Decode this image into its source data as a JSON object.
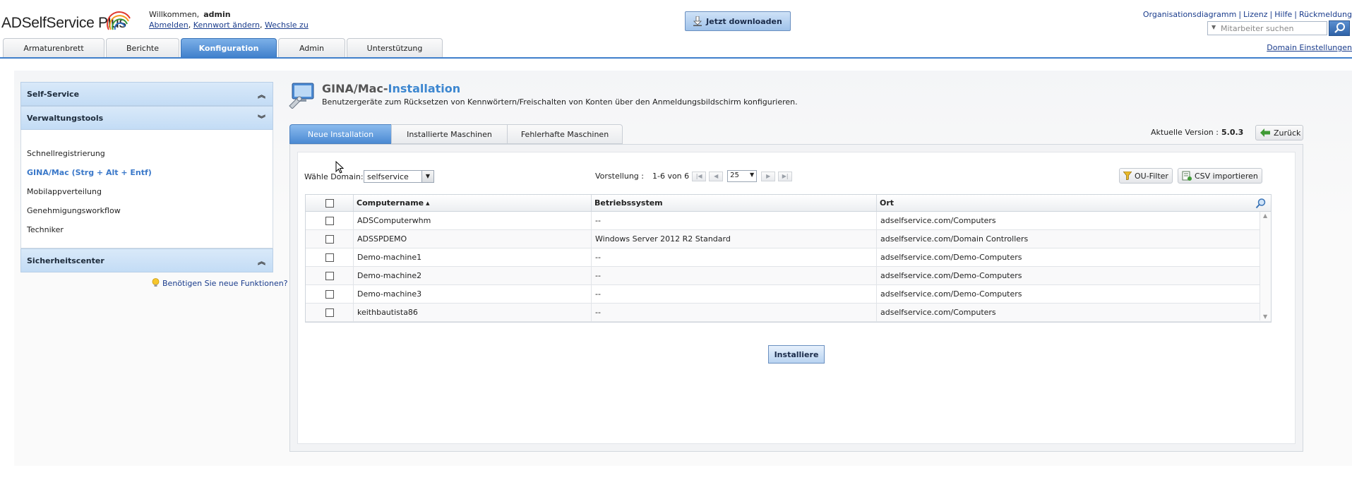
{
  "app": {
    "logo_text": "ADSelfService",
    "logo_plus": " Plus",
    "welcome": "Willkommen,",
    "user": "admin",
    "links": [
      {
        "label": "Abmelden"
      },
      {
        "label": "Kennwort ändern"
      },
      {
        "label": "Wechsle zu"
      }
    ],
    "download_label": "Jetzt downloaden",
    "top_links": [
      "Organisationsdiagramm",
      "Lizenz",
      "Hilfe",
      "Rückmeldung"
    ],
    "search_placeholder": "Mitarbeiter suchen",
    "domain_settings": "Domain Einstellungen"
  },
  "tabs": [
    {
      "label": "Armaturenbrett",
      "active": false
    },
    {
      "label": "Berichte",
      "active": false
    },
    {
      "label": "Konfiguration",
      "active": true
    },
    {
      "label": "Admin",
      "active": false
    },
    {
      "label": "Unterstützung",
      "active": false
    }
  ],
  "sidebar": {
    "sections": {
      "self_service": "Self-Service",
      "admin_tools": "Verwaltungstools",
      "security": "Sicherheitscenter"
    },
    "items": [
      {
        "label": "Schnellregistrierung",
        "active": false
      },
      {
        "label": "GINA/Mac (Strg + Alt + Entf)",
        "active": true
      },
      {
        "label": "Mobilappverteilung",
        "active": false
      },
      {
        "label": "Genehmigungsworkflow",
        "active": false
      },
      {
        "label": "Techniker",
        "active": false
      }
    ],
    "new_features": "Benötigen Sie neue Funktionen?"
  },
  "page": {
    "title_prefix": "GINA/Mac-",
    "title_accent": "Installation",
    "description": "Benutzergeräte zum Rücksetzen von Kennwörtern/Freischalten von Konten über den Anmeldungsbildschirm konfigurieren.",
    "subtabs": [
      {
        "label": "Neue Installation",
        "active": true
      },
      {
        "label": "Installierte Maschinen",
        "active": false
      },
      {
        "label": "Fehlerhafte Maschinen",
        "active": false
      }
    ],
    "version_label": "Aktuelle Version :",
    "version_value": "5.0.3",
    "back_label": "Zurück"
  },
  "filters": {
    "domain_label": "Wähle Domain:",
    "domain_value": "selfservice",
    "pager_label": "Vorstellung :",
    "pager_range": "1-6 von 6",
    "per_page": "25",
    "ou_filter": "OU-Filter",
    "csv_import": "CSV importieren"
  },
  "table": {
    "columns": [
      "Computername",
      "Betriebssystem",
      "Ort"
    ],
    "rows": [
      [
        "ADSComputerwhm",
        "--",
        "adselfservice.com/Computers"
      ],
      [
        "ADSSPDEMO",
        "Windows Server 2012 R2 Standard",
        "adselfservice.com/Domain Controllers"
      ],
      [
        "Demo-machine1",
        "--",
        "adselfservice.com/Demo-Computers"
      ],
      [
        "Demo-machine2",
        "--",
        "adselfservice.com/Demo-Computers"
      ],
      [
        "Demo-machine3",
        "--",
        "adselfservice.com/Demo-Computers"
      ],
      [
        "keithbautista86",
        "--",
        "adselfservice.com/Computers"
      ]
    ]
  },
  "install_label": "Installiere",
  "colors": {
    "accent": "#3f7fcb",
    "link": "#1a3c8c",
    "sidebar_header": "#c3dcf5"
  }
}
